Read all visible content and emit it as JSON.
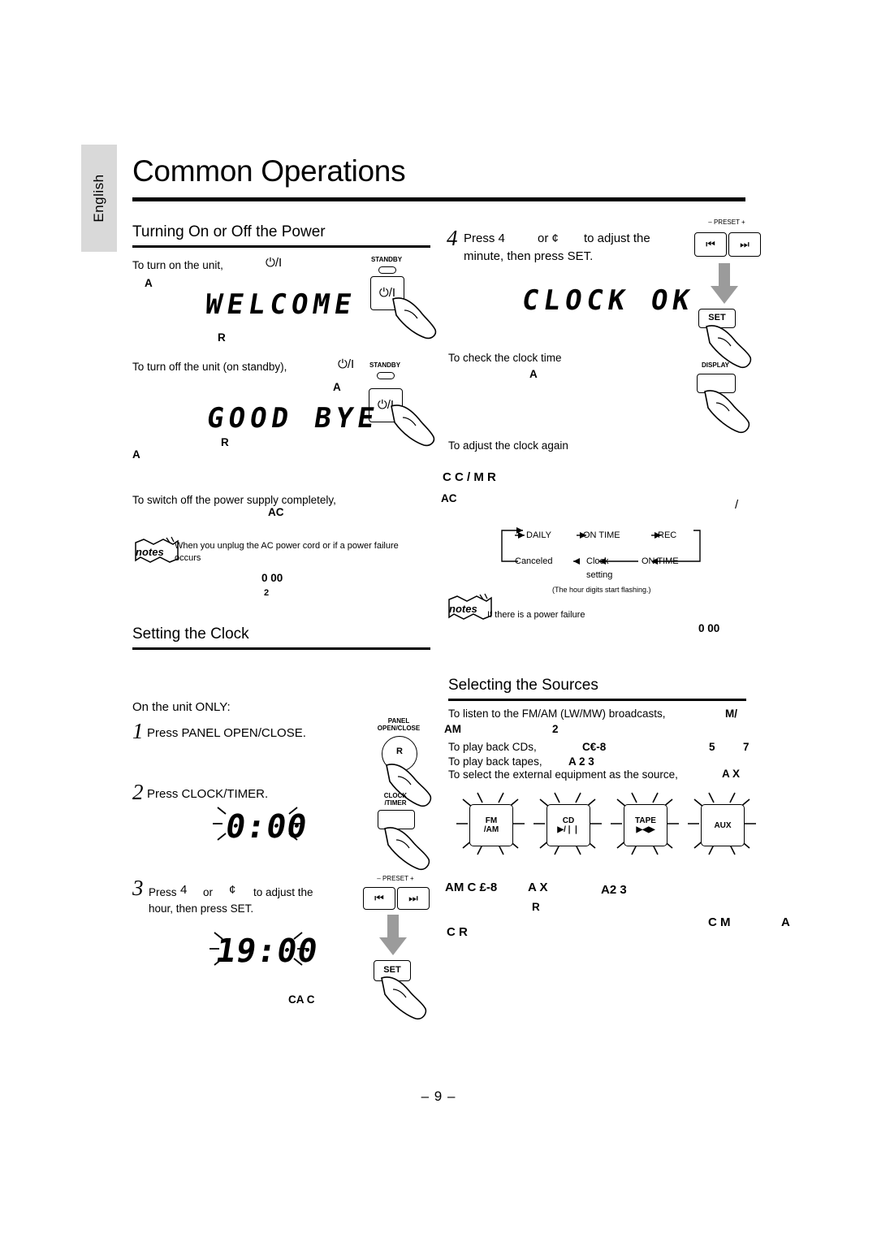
{
  "sidebar": {
    "language": "English"
  },
  "header": {
    "title": "Common Operations"
  },
  "left": {
    "section1_title": "Turning On or Off the Power",
    "turn_on_text": "To turn on the unit,",
    "turn_on_key": "⏻/I",
    "standby_label": "STANDBY",
    "welcome_display": "WELCOME",
    "a_mark1": "A",
    "r_mark1": "R",
    "turn_off_text": "To turn off the unit (on standby),",
    "turn_off_key": "⏻/I",
    "goodbye_display": "GOOD BYE",
    "a_mark2": "A",
    "r_mark2": "R",
    "a_mark3": "A",
    "switch_off_text": "To switch off the power supply completely,",
    "ac_label": "AC",
    "ac_label2": "AC",
    "note1_text": "When you unplug the AC power cord or if a power failure occurs",
    "note1_code": "0 00",
    "note1_code2": "2",
    "section2_title": "Setting the Clock",
    "unit_only": "On the unit ONLY:",
    "step1_num": "1",
    "step1_text": "Press PANEL OPEN/CLOSE.",
    "panel_key_l1": "PANEL",
    "panel_key_l2": "OPEN/CLOSE",
    "panel_r": "R",
    "step2_num": "2",
    "step2_text": "Press CLOCK/TIMER.",
    "clock_key_l1": "CLOCK",
    "clock_key_l2": "/TIMER",
    "display_000": "0:00",
    "step3_num": "3",
    "step3_text_a": "Press",
    "step3_text_b": "4",
    "step3_text_c": "or",
    "step3_text_d": "¢",
    "step3_text_e": "to adjust the",
    "step3_text_f": "hour, then press SET.",
    "preset_label": "– PRESET +",
    "btn_prev": "⏮",
    "btn_next": "⏭",
    "set_label": "SET",
    "display_1900": "19:00",
    "ca_c": "CA  C"
  },
  "right": {
    "step4_num": "4",
    "step4_text_a": "Press 4",
    "step4_text_b": "or ¢",
    "step4_text_c": "to adjust the",
    "step4_text_d": "minute, then press SET.",
    "preset_label": "– PRESET +",
    "btn_prev": "⏮",
    "btn_next": "⏭",
    "set_label": "SET",
    "clock_ok_display": "CLOCK OK",
    "check_clock_text": "To check the clock time",
    "check_a": "A",
    "display_label": "DISPLAY",
    "adjust_again_text": "To adjust the clock again",
    "adjust_again_code": "C   C / M  R",
    "slash_mark": "/",
    "flow": {
      "daily": "DAILY",
      "on_time": "ON TIME",
      "rec": "REC",
      "canceled": "Canceled",
      "clock": "Clock",
      "on_time2": "ON TIME",
      "setting": "setting",
      "caption": "(The hour digits start flashing.)"
    },
    "note2_text": "If there is a power failure",
    "note2_code": "0 00",
    "section3_title": "Selecting the Sources",
    "line1_text": "To listen to the FM/AM (LW/MW) broadcasts,",
    "line1_code": "M/",
    "line1_code2": "AM",
    "line1_code3": "2",
    "line2_text": "To play back CDs,",
    "line2_code": "C€-8",
    "line2_code2": "5",
    "line2_code3": "7",
    "line3_text": "To play back tapes,",
    "line3_code": "A 2   3",
    "line4_text": "To select the external equipment as the source,",
    "line4_code": "A  X",
    "src_buttons": [
      {
        "l1": "FM",
        "l2": "/AM"
      },
      {
        "l1": "CD",
        "l2": "▶/❘❘"
      },
      {
        "l1": "TAPE",
        "l2": "▶◀▶"
      },
      {
        "l1": "AUX",
        "l2": ""
      }
    ],
    "footer_codes": {
      "c1": "AM  C  £-8",
      "c2": "A  X",
      "c3": "A2  3",
      "c4": "R",
      "c5": "C      R",
      "c6": "C  M",
      "c7": "A"
    }
  },
  "footer": {
    "page": "– 9 –"
  },
  "icons": {
    "notes": "notes",
    "power": "power-icon",
    "arrow_down": "arrow-down-icon"
  }
}
